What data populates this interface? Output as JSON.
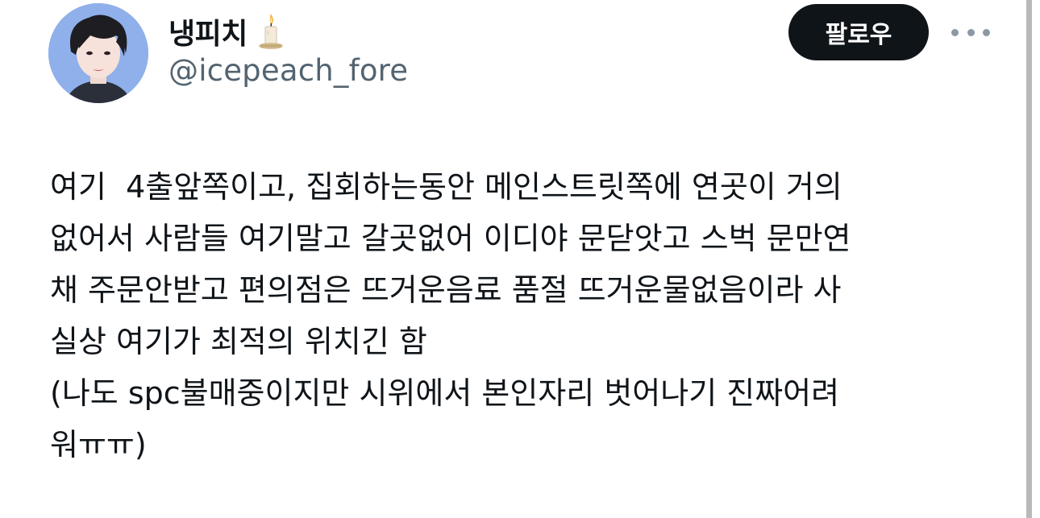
{
  "author": {
    "display_name": "냉피치",
    "name_emoji": "candle-icon",
    "handle": "@icepeach_fore"
  },
  "actions": {
    "follow_label": "팔로우",
    "more_icon": "more-dots-icon"
  },
  "tweet": {
    "lines": [
      "여기  4출앞쪽이고, 집회하는동안 메인스트릿쪽에 연곳이 거의",
      "없어서 사람들 여기말고 갈곳없어 이디야 문닫앗고 스벅 문만연",
      "채 주문안받고 편의점은 뜨거운음료 품절 뜨거운물없음이라 사",
      "실상 여기가 최적의 위치긴 함",
      "(나도 spc불매중이지만 시위에서 본인자리 벗어나기 진짜어려",
      "워ㅠㅠ)"
    ]
  },
  "colors": {
    "text_primary": "#0f1419",
    "text_secondary": "#536471",
    "button_bg": "#0f1419",
    "button_text": "#ffffff",
    "more_dots": "#8b98a5"
  }
}
